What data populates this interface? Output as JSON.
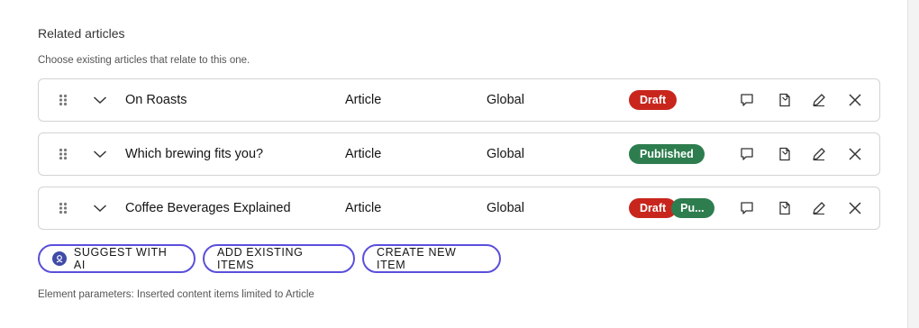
{
  "section": {
    "title": "Related articles",
    "subtitle": "Choose existing articles that relate to this one."
  },
  "items": [
    {
      "name": "On Roasts",
      "type": "Article",
      "scope": "Global",
      "badges": [
        "Draft"
      ]
    },
    {
      "name": "Which brewing fits you?",
      "type": "Article",
      "scope": "Global",
      "badges": [
        "Published"
      ]
    },
    {
      "name": "Coffee Beverages Explained",
      "type": "Article",
      "scope": "Global",
      "badges": [
        "Draft",
        "Pu..."
      ]
    }
  ],
  "buttons": {
    "suggest": "SUGGEST WITH AI",
    "add_existing": "ADD EXISTING ITEMS",
    "create_new": "CREATE NEW ITEM"
  },
  "footer": "Element parameters: Inserted content items limited to Article",
  "icons": {
    "drag": "drag-handle-icon",
    "expand": "chevron-down-icon",
    "comment": "comment-icon",
    "copy": "copy-icon",
    "edit": "edit-icon",
    "remove": "close-icon",
    "ai": "ai-icon"
  },
  "colors": {
    "accent": "#5b4fdb",
    "draft": "#c8261d",
    "published": "#2e7d4f"
  }
}
